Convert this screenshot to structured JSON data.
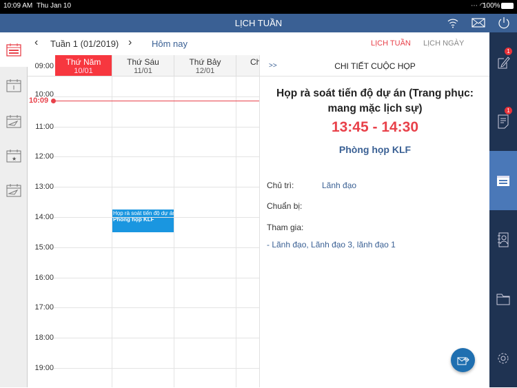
{
  "status": {
    "time": "10:09 AM",
    "date": "Thu Jan 10",
    "battery": "100%"
  },
  "header": {
    "title": "LỊCH TUẦN"
  },
  "toolbar": {
    "week": "Tuần 1 (01/2019)",
    "today": "Hôm nay",
    "tab_week": "LỊCH TUẦN",
    "tab_day": "LỊCH NGÀY"
  },
  "days": [
    {
      "name": "Thứ Năm",
      "date": "10/01"
    },
    {
      "name": "Thứ Sáu",
      "date": "11/01"
    },
    {
      "name": "Thứ Bảy",
      "date": "12/01"
    },
    {
      "name": "Ch",
      "date": ""
    }
  ],
  "hours": [
    "09:00",
    "10:00",
    "11:00",
    "12:00",
    "13:00",
    "14:00",
    "15:00",
    "16:00",
    "17:00",
    "18:00",
    "19:00"
  ],
  "now": "10:09",
  "event": {
    "title": "Họp rà soát tiến độ dự án",
    "room": "Phòng họp KLF"
  },
  "detail": {
    "collapse": ">>",
    "heading": "CHI TIẾT CUỘC HỌP",
    "title": "Họp rà soát tiến độ dự án (Trang phục: mang mặc lịch sự)",
    "time": "13:45 - 14:30",
    "room": "Phòng họp KLF",
    "chair_label": "Chủ trì:",
    "chair": "Lãnh đạo",
    "prep_label": "Chuẩn bị:",
    "attend_label": "Tham gia:",
    "attendees": "- Lãnh đạo, Lãnh đạo 3, lãnh đạo 1"
  },
  "badges": {
    "drafts": "1",
    "documents": "1"
  },
  "colors": {
    "header": "#3a6094",
    "accent": "#e8414a",
    "sidebar": "#1f3352",
    "event": "#1a96e0"
  }
}
